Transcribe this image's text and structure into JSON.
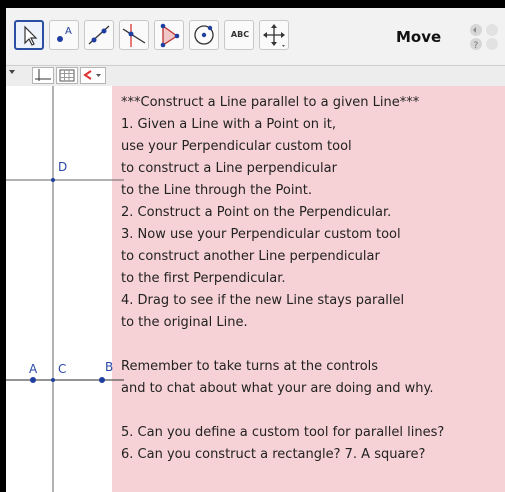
{
  "toolbar": {
    "tools": [
      {
        "name": "move-tool",
        "icon": "arrow-cursor-icon",
        "selected": true
      },
      {
        "name": "point-tool",
        "icon": "point-A-icon"
      },
      {
        "name": "line-tool",
        "icon": "line-through-points-icon"
      },
      {
        "name": "perpendicular-tool",
        "icon": "perpendicular-line-icon"
      },
      {
        "name": "polygon-tool",
        "icon": "polygon-icon"
      },
      {
        "name": "circle-tool",
        "icon": "circle-center-point-icon"
      },
      {
        "name": "text-tool",
        "icon": "abc-text-icon",
        "label": "ABC"
      },
      {
        "name": "move-view-tool",
        "icon": "move-graphics-view-icon"
      }
    ],
    "mode_label": "Move"
  },
  "subbar": {
    "buttons": [
      "axes-toggle-icon",
      "grid-toggle-icon",
      "color-dropdown-icon"
    ]
  },
  "points": {
    "A": "A",
    "B": "B",
    "C": "C",
    "D": "D"
  },
  "instructions": [
    "***Construct a Line parallel to a given Line***",
    "1. Given a Line with a Point on it,",
    "use your Perpendicular custom tool",
    "to construct a Line perpendicular",
    "to the Line through the Point.",
    "2. Construct a Point on the Perpendicular.",
    "3. Now use your Perpendicular custom tool",
    "to construct another Line perpendicular",
    "to the first Perpendicular.",
    "4. Drag to see if the new Line stays parallel",
    "to the original Line.",
    "",
    "Remember to take turns at the controls",
    "and to chat about what your are doing and why.",
    "",
    "5. Can you define a custom tool for parallel lines?",
    "6. Can you construct a rectangle? 7. A square?"
  ],
  "colors": {
    "accent": "#2d4fa3",
    "textbox_bg": "#f6d2d6",
    "point": "#1f3fa0"
  }
}
